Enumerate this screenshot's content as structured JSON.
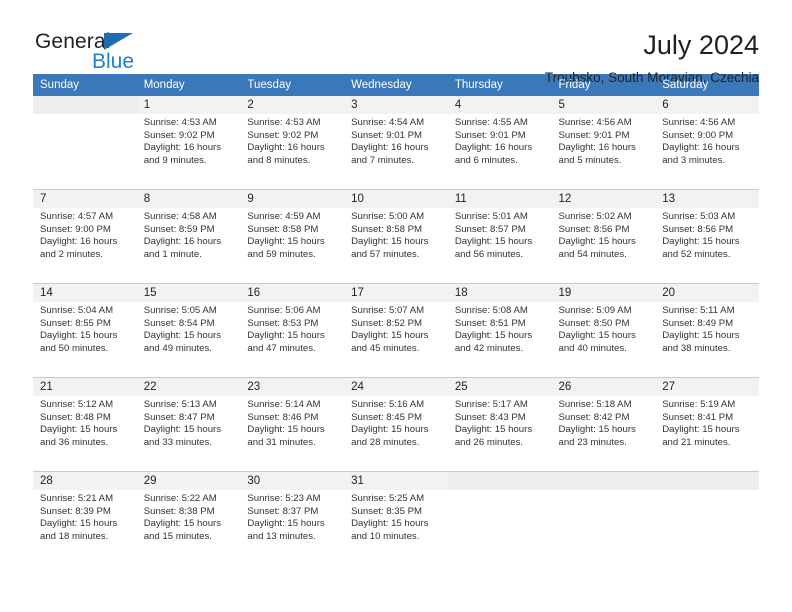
{
  "brand": {
    "name_part1": "General",
    "name_part2": "Blue",
    "triangle_color": "#1e6cb3",
    "blue_color": "#1f7fd0"
  },
  "header": {
    "title": "July 2024",
    "subtitle": "Troubsko, South Moravian, Czechia"
  },
  "theme": {
    "header_row_bg": "#3a78ba",
    "day_number_bg": "#f2f2f2",
    "cell_bg": "#ffffff",
    "rule_color": "#c9c9c9",
    "text_color": "#231f20"
  },
  "weekday_headers": [
    "Sunday",
    "Monday",
    "Tuesday",
    "Wednesday",
    "Thursday",
    "Friday",
    "Saturday"
  ],
  "weeks": [
    {
      "days": [
        {
          "number": "",
          "lines": []
        },
        {
          "number": "1",
          "lines": [
            "Sunrise: 4:53 AM",
            "Sunset: 9:02 PM",
            "Daylight: 16 hours",
            "and 9 minutes."
          ]
        },
        {
          "number": "2",
          "lines": [
            "Sunrise: 4:53 AM",
            "Sunset: 9:02 PM",
            "Daylight: 16 hours",
            "and 8 minutes."
          ]
        },
        {
          "number": "3",
          "lines": [
            "Sunrise: 4:54 AM",
            "Sunset: 9:01 PM",
            "Daylight: 16 hours",
            "and 7 minutes."
          ]
        },
        {
          "number": "4",
          "lines": [
            "Sunrise: 4:55 AM",
            "Sunset: 9:01 PM",
            "Daylight: 16 hours",
            "and 6 minutes."
          ]
        },
        {
          "number": "5",
          "lines": [
            "Sunrise: 4:56 AM",
            "Sunset: 9:01 PM",
            "Daylight: 16 hours",
            "and 5 minutes."
          ]
        },
        {
          "number": "6",
          "lines": [
            "Sunrise: 4:56 AM",
            "Sunset: 9:00 PM",
            "Daylight: 16 hours",
            "and 3 minutes."
          ]
        }
      ]
    },
    {
      "days": [
        {
          "number": "7",
          "lines": [
            "Sunrise: 4:57 AM",
            "Sunset: 9:00 PM",
            "Daylight: 16 hours",
            "and 2 minutes."
          ]
        },
        {
          "number": "8",
          "lines": [
            "Sunrise: 4:58 AM",
            "Sunset: 8:59 PM",
            "Daylight: 16 hours",
            "and 1 minute."
          ]
        },
        {
          "number": "9",
          "lines": [
            "Sunrise: 4:59 AM",
            "Sunset: 8:58 PM",
            "Daylight: 15 hours",
            "and 59 minutes."
          ]
        },
        {
          "number": "10",
          "lines": [
            "Sunrise: 5:00 AM",
            "Sunset: 8:58 PM",
            "Daylight: 15 hours",
            "and 57 minutes."
          ]
        },
        {
          "number": "11",
          "lines": [
            "Sunrise: 5:01 AM",
            "Sunset: 8:57 PM",
            "Daylight: 15 hours",
            "and 56 minutes."
          ]
        },
        {
          "number": "12",
          "lines": [
            "Sunrise: 5:02 AM",
            "Sunset: 8:56 PM",
            "Daylight: 15 hours",
            "and 54 minutes."
          ]
        },
        {
          "number": "13",
          "lines": [
            "Sunrise: 5:03 AM",
            "Sunset: 8:56 PM",
            "Daylight: 15 hours",
            "and 52 minutes."
          ]
        }
      ]
    },
    {
      "days": [
        {
          "number": "14",
          "lines": [
            "Sunrise: 5:04 AM",
            "Sunset: 8:55 PM",
            "Daylight: 15 hours",
            "and 50 minutes."
          ]
        },
        {
          "number": "15",
          "lines": [
            "Sunrise: 5:05 AM",
            "Sunset: 8:54 PM",
            "Daylight: 15 hours",
            "and 49 minutes."
          ]
        },
        {
          "number": "16",
          "lines": [
            "Sunrise: 5:06 AM",
            "Sunset: 8:53 PM",
            "Daylight: 15 hours",
            "and 47 minutes."
          ]
        },
        {
          "number": "17",
          "lines": [
            "Sunrise: 5:07 AM",
            "Sunset: 8:52 PM",
            "Daylight: 15 hours",
            "and 45 minutes."
          ]
        },
        {
          "number": "18",
          "lines": [
            "Sunrise: 5:08 AM",
            "Sunset: 8:51 PM",
            "Daylight: 15 hours",
            "and 42 minutes."
          ]
        },
        {
          "number": "19",
          "lines": [
            "Sunrise: 5:09 AM",
            "Sunset: 8:50 PM",
            "Daylight: 15 hours",
            "and 40 minutes."
          ]
        },
        {
          "number": "20",
          "lines": [
            "Sunrise: 5:11 AM",
            "Sunset: 8:49 PM",
            "Daylight: 15 hours",
            "and 38 minutes."
          ]
        }
      ]
    },
    {
      "days": [
        {
          "number": "21",
          "lines": [
            "Sunrise: 5:12 AM",
            "Sunset: 8:48 PM",
            "Daylight: 15 hours",
            "and 36 minutes."
          ]
        },
        {
          "number": "22",
          "lines": [
            "Sunrise: 5:13 AM",
            "Sunset: 8:47 PM",
            "Daylight: 15 hours",
            "and 33 minutes."
          ]
        },
        {
          "number": "23",
          "lines": [
            "Sunrise: 5:14 AM",
            "Sunset: 8:46 PM",
            "Daylight: 15 hours",
            "and 31 minutes."
          ]
        },
        {
          "number": "24",
          "lines": [
            "Sunrise: 5:16 AM",
            "Sunset: 8:45 PM",
            "Daylight: 15 hours",
            "and 28 minutes."
          ]
        },
        {
          "number": "25",
          "lines": [
            "Sunrise: 5:17 AM",
            "Sunset: 8:43 PM",
            "Daylight: 15 hours",
            "and 26 minutes."
          ]
        },
        {
          "number": "26",
          "lines": [
            "Sunrise: 5:18 AM",
            "Sunset: 8:42 PM",
            "Daylight: 15 hours",
            "and 23 minutes."
          ]
        },
        {
          "number": "27",
          "lines": [
            "Sunrise: 5:19 AM",
            "Sunset: 8:41 PM",
            "Daylight: 15 hours",
            "and 21 minutes."
          ]
        }
      ]
    },
    {
      "days": [
        {
          "number": "28",
          "lines": [
            "Sunrise: 5:21 AM",
            "Sunset: 8:39 PM",
            "Daylight: 15 hours",
            "and 18 minutes."
          ]
        },
        {
          "number": "29",
          "lines": [
            "Sunrise: 5:22 AM",
            "Sunset: 8:38 PM",
            "Daylight: 15 hours",
            "and 15 minutes."
          ]
        },
        {
          "number": "30",
          "lines": [
            "Sunrise: 5:23 AM",
            "Sunset: 8:37 PM",
            "Daylight: 15 hours",
            "and 13 minutes."
          ]
        },
        {
          "number": "31",
          "lines": [
            "Sunrise: 5:25 AM",
            "Sunset: 8:35 PM",
            "Daylight: 15 hours",
            "and 10 minutes."
          ]
        },
        {
          "number": "",
          "lines": []
        },
        {
          "number": "",
          "lines": []
        },
        {
          "number": "",
          "lines": []
        }
      ]
    }
  ]
}
